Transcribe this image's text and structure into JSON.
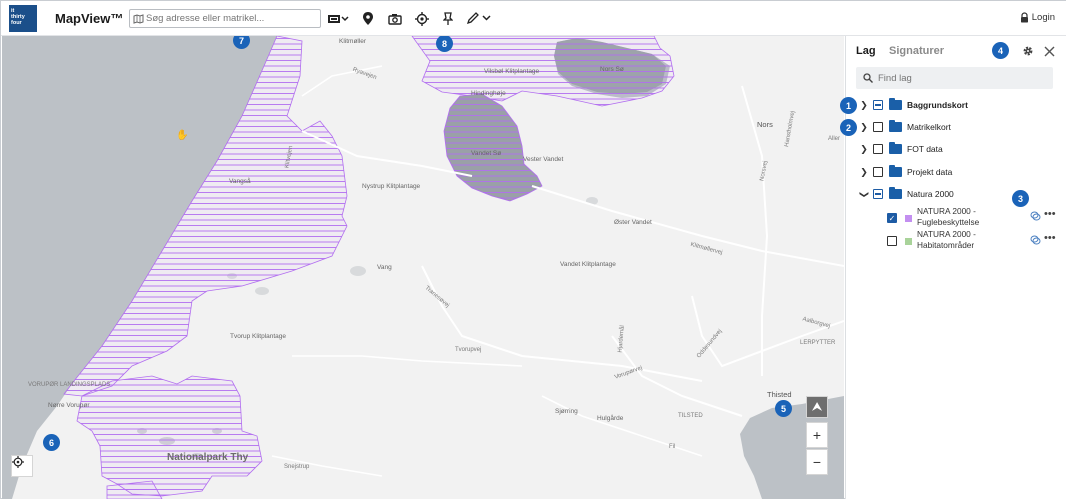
{
  "app": {
    "logo_lines": [
      "it",
      "thirty",
      "four"
    ],
    "title": "MapView™",
    "login_label": "Login"
  },
  "search": {
    "placeholder": "Søg adresse eller matrikel..."
  },
  "toolbar": {
    "icons": [
      "basemap-icon",
      "map-info-icon",
      "camera-icon",
      "locate-icon",
      "pin-icon",
      "draw-icon"
    ]
  },
  "map": {
    "labels": {
      "kliitmoller": "Klitmøller",
      "ryaavejen": "Ryavejen",
      "vilsbol": "Vilsbøl Klitplantage",
      "norsso": "Nors Sø",
      "hinding": "Hindinghøje",
      "vandet_so": "Vandet Sø",
      "vester_vandet": "Vester Vandet",
      "nors": "Nors",
      "vangsaa": "Vangså",
      "nystrup": "Nystrup Klitplantage",
      "klitvejen": "Klitvejen",
      "oster_vandet": "Øster Vandet",
      "vang": "Vang",
      "vandet_klit": "Vandet Klitplantage",
      "tvorup_klit": "Tvorup Klitplantage",
      "tvorupvej": "Tvorupvej",
      "norre_vorupor": "Nørre Vorupør",
      "vorupor_landing": "VORUPØR LANDINGSPLADS",
      "nationalpark": "Nationalpark Thy",
      "sjorring": "Sjørring",
      "hulgarde": "Hulgårde",
      "tilsted": "TILSTED",
      "thisted": "Thisted",
      "snejstrup": "Snejstrup",
      "lerpytter": "LERPYTTER",
      "vorupor_vej": "Vorupørvej",
      "aalborgvej": "Aalborgvej",
      "hanstholmvej": "Hanstholmvej",
      "norsvej": "Norsvej",
      "klitmollervej": "Klitmøllervej",
      "hjardemal": "Hjardemål",
      "oddesundvej": "Oddesundvej",
      "tranesvej": "Tranesøvej",
      "fil": "Fil",
      "aller": "Aller"
    },
    "markers": [
      "7",
      "8",
      "6",
      "5"
    ]
  },
  "panel": {
    "tabs": [
      "Lag",
      "Signaturer"
    ],
    "marker": "4",
    "find_placeholder": "Find lag",
    "layers": [
      {
        "marker": "1",
        "label": "Baggrundskort",
        "state": "partial",
        "bold": true
      },
      {
        "marker": "2",
        "label": "Matrikelkort",
        "state": "unchecked",
        "bold": false
      },
      {
        "label": "FOT data",
        "state": "unchecked",
        "bold": false
      },
      {
        "label": "Projekt data",
        "state": "unchecked",
        "bold": false
      },
      {
        "label": "Natura 2000",
        "state": "partial",
        "bold": false,
        "expanded": true
      }
    ],
    "sublayer_marker": "3",
    "sublayers": [
      {
        "line1": "NATURA 2000 -",
        "line2": "Fuglebeskyttelse",
        "checked": true,
        "color": "#c38ff0"
      },
      {
        "line1": "NATURA 2000 -",
        "line2": "Habitatområder",
        "checked": false,
        "color": "#a9d39a"
      }
    ]
  },
  "colors": {
    "accent": "#1a63b8",
    "fugle_hatch": "#b26ef0",
    "water": "#b9bec4",
    "land": "#f2f2f2"
  }
}
